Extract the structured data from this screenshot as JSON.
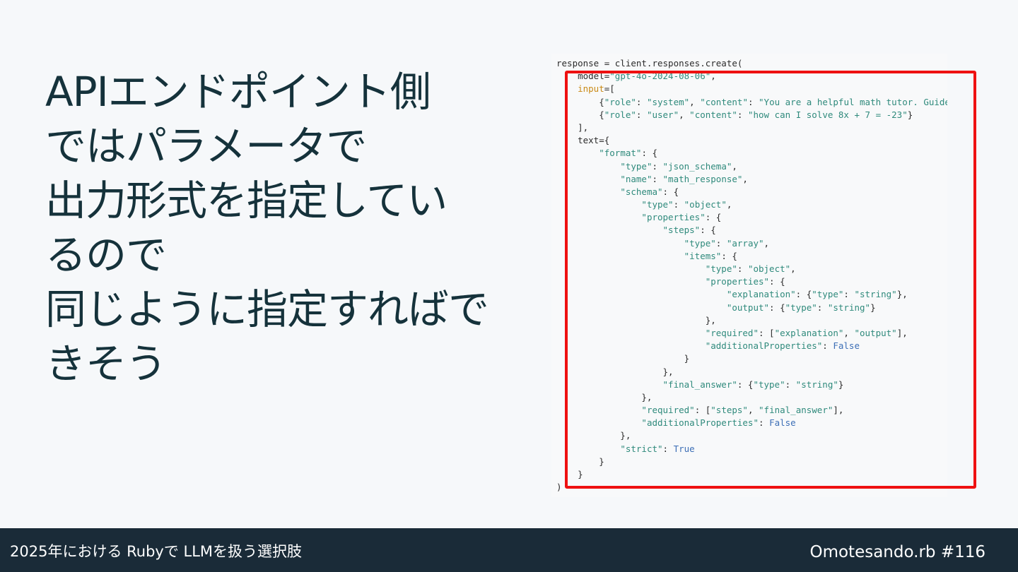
{
  "slide": {
    "title_lines": [
      "APIエンドポイント側",
      "ではパラメータで",
      "出力形式を指定してい",
      "るので",
      "同じように指定すればで",
      "きそう"
    ]
  },
  "code": {
    "lines": [
      [
        {
          "t": "response = client.responses.create("
        }
      ],
      [
        {
          "t": "    model="
        },
        {
          "t": "\"gpt-4o-2024-08-06\"",
          "c": "s"
        },
        {
          "t": ","
        }
      ],
      [
        {
          "t": "    "
        },
        {
          "t": "input",
          "c": "m"
        },
        {
          "t": "=["
        }
      ],
      [
        {
          "t": "        {"
        },
        {
          "t": "\"role\"",
          "c": "s"
        },
        {
          "t": ": "
        },
        {
          "t": "\"system\"",
          "c": "s"
        },
        {
          "t": ", "
        },
        {
          "t": "\"content\"",
          "c": "s"
        },
        {
          "t": ": "
        },
        {
          "t": "\"You are a helpful math tutor. Guide",
          "c": "s"
        }
      ],
      [
        {
          "t": "        {"
        },
        {
          "t": "\"role\"",
          "c": "s"
        },
        {
          "t": ": "
        },
        {
          "t": "\"user\"",
          "c": "s"
        },
        {
          "t": ", "
        },
        {
          "t": "\"content\"",
          "c": "s"
        },
        {
          "t": ": "
        },
        {
          "t": "\"how can I solve 8x + 7 = -23\"",
          "c": "s"
        },
        {
          "t": "}"
        }
      ],
      [
        {
          "t": "    ],"
        }
      ],
      [
        {
          "t": "    text={"
        }
      ],
      [
        {
          "t": "        "
        },
        {
          "t": "\"format\"",
          "c": "s"
        },
        {
          "t": ": {"
        }
      ],
      [
        {
          "t": "            "
        },
        {
          "t": "\"type\"",
          "c": "s"
        },
        {
          "t": ": "
        },
        {
          "t": "\"json_schema\"",
          "c": "s"
        },
        {
          "t": ","
        }
      ],
      [
        {
          "t": "            "
        },
        {
          "t": "\"name\"",
          "c": "s"
        },
        {
          "t": ": "
        },
        {
          "t": "\"math_response\"",
          "c": "s"
        },
        {
          "t": ","
        }
      ],
      [
        {
          "t": "            "
        },
        {
          "t": "\"schema\"",
          "c": "s"
        },
        {
          "t": ": {"
        }
      ],
      [
        {
          "t": "                "
        },
        {
          "t": "\"type\"",
          "c": "s"
        },
        {
          "t": ": "
        },
        {
          "t": "\"object\"",
          "c": "s"
        },
        {
          "t": ","
        }
      ],
      [
        {
          "t": "                "
        },
        {
          "t": "\"properties\"",
          "c": "s"
        },
        {
          "t": ": {"
        }
      ],
      [
        {
          "t": "                    "
        },
        {
          "t": "\"steps\"",
          "c": "s"
        },
        {
          "t": ": {"
        }
      ],
      [
        {
          "t": "                        "
        },
        {
          "t": "\"type\"",
          "c": "s"
        },
        {
          "t": ": "
        },
        {
          "t": "\"array\"",
          "c": "s"
        },
        {
          "t": ","
        }
      ],
      [
        {
          "t": "                        "
        },
        {
          "t": "\"items\"",
          "c": "s"
        },
        {
          "t": ": {"
        }
      ],
      [
        {
          "t": "                            "
        },
        {
          "t": "\"type\"",
          "c": "s"
        },
        {
          "t": ": "
        },
        {
          "t": "\"object\"",
          "c": "s"
        },
        {
          "t": ","
        }
      ],
      [
        {
          "t": "                            "
        },
        {
          "t": "\"properties\"",
          "c": "s"
        },
        {
          "t": ": {"
        }
      ],
      [
        {
          "t": "                                "
        },
        {
          "t": "\"explanation\"",
          "c": "s"
        },
        {
          "t": ": {"
        },
        {
          "t": "\"type\"",
          "c": "s"
        },
        {
          "t": ": "
        },
        {
          "t": "\"string\"",
          "c": "s"
        },
        {
          "t": "},"
        }
      ],
      [
        {
          "t": "                                "
        },
        {
          "t": "\"output\"",
          "c": "s"
        },
        {
          "t": ": {"
        },
        {
          "t": "\"type\"",
          "c": "s"
        },
        {
          "t": ": "
        },
        {
          "t": "\"string\"",
          "c": "s"
        },
        {
          "t": "}"
        }
      ],
      [
        {
          "t": "                            },"
        }
      ],
      [
        {
          "t": "                            "
        },
        {
          "t": "\"required\"",
          "c": "s"
        },
        {
          "t": ": ["
        },
        {
          "t": "\"explanation\"",
          "c": "s"
        },
        {
          "t": ", "
        },
        {
          "t": "\"output\"",
          "c": "s"
        },
        {
          "t": "],"
        }
      ],
      [
        {
          "t": "                            "
        },
        {
          "t": "\"additionalProperties\"",
          "c": "s"
        },
        {
          "t": ": "
        },
        {
          "t": "False",
          "c": "k"
        }
      ],
      [
        {
          "t": "                        }"
        }
      ],
      [
        {
          "t": "                    },"
        }
      ],
      [
        {
          "t": "                    "
        },
        {
          "t": "\"final_answer\"",
          "c": "s"
        },
        {
          "t": ": {"
        },
        {
          "t": "\"type\"",
          "c": "s"
        },
        {
          "t": ": "
        },
        {
          "t": "\"string\"",
          "c": "s"
        },
        {
          "t": "}"
        }
      ],
      [
        {
          "t": "                },"
        }
      ],
      [
        {
          "t": "                "
        },
        {
          "t": "\"required\"",
          "c": "s"
        },
        {
          "t": ": ["
        },
        {
          "t": "\"steps\"",
          "c": "s"
        },
        {
          "t": ", "
        },
        {
          "t": "\"final_answer\"",
          "c": "s"
        },
        {
          "t": "],"
        }
      ],
      [
        {
          "t": "                "
        },
        {
          "t": "\"additionalProperties\"",
          "c": "s"
        },
        {
          "t": ": "
        },
        {
          "t": "False",
          "c": "k"
        }
      ],
      [
        {
          "t": "            },"
        }
      ],
      [
        {
          "t": "            "
        },
        {
          "t": "\"strict\"",
          "c": "s"
        },
        {
          "t": ": "
        },
        {
          "t": "True",
          "c": "k"
        }
      ],
      [
        {
          "t": "        }"
        }
      ],
      [
        {
          "t": "    }"
        }
      ],
      [
        {
          "t": ")"
        }
      ]
    ]
  },
  "footer": {
    "left": "2025年における Rubyで LLMを扱う選択肢",
    "right": "Omotesando.rb #116"
  },
  "colors": {
    "background": "#f6f8fa",
    "title_text": "#15323b",
    "highlight_border": "#ee1111",
    "footer_bg": "#1a2b38",
    "code_string": "#2f8a7c",
    "code_keyword": "#3d6fb6",
    "code_builtin": "#c98a16"
  }
}
